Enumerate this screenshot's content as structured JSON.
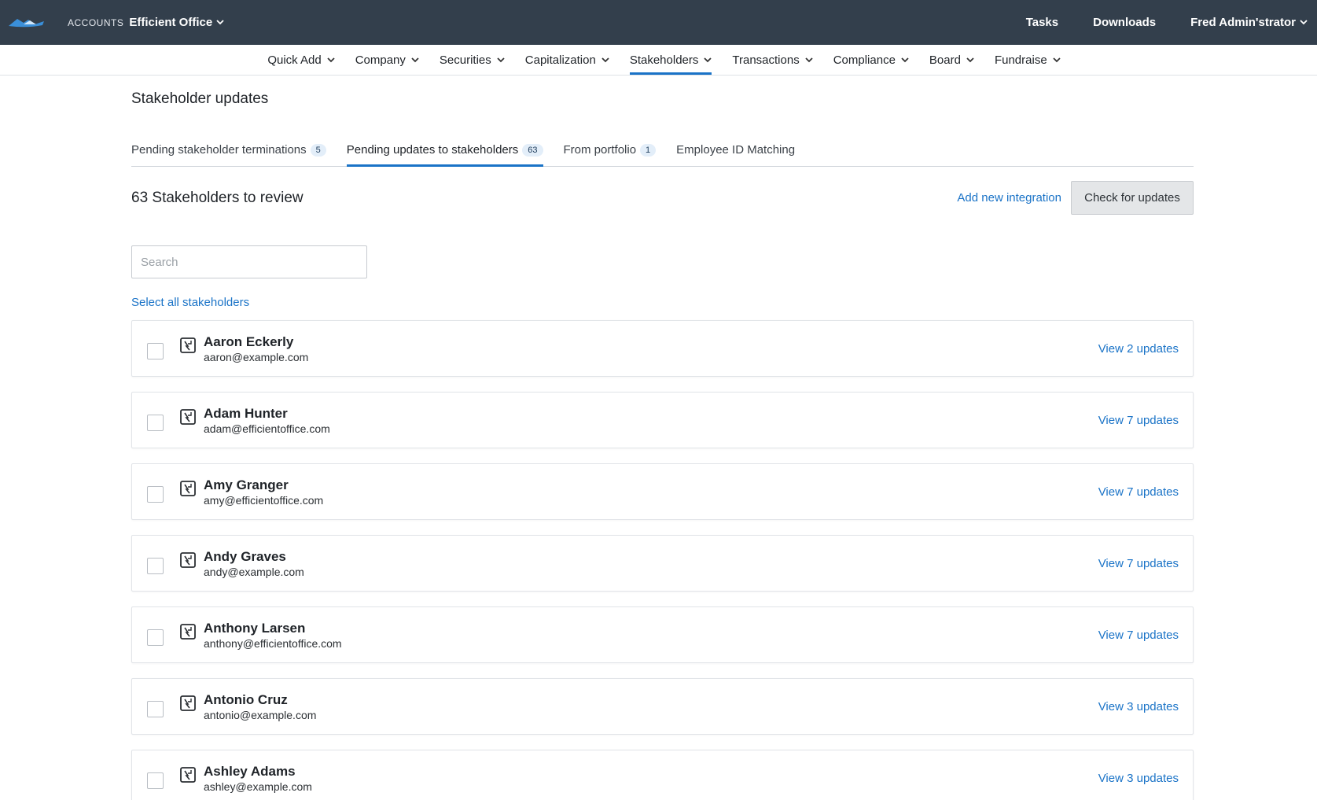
{
  "topbar": {
    "accounts_label": "ACCOUNTS",
    "company_name": "Efficient Office",
    "tasks": "Tasks",
    "downloads": "Downloads",
    "user_name": "Fred Admin'strator"
  },
  "nav": {
    "items": [
      {
        "label": "Quick Add"
      },
      {
        "label": "Company"
      },
      {
        "label": "Securities"
      },
      {
        "label": "Capitalization"
      },
      {
        "label": "Stakeholders",
        "active": true
      },
      {
        "label": "Transactions"
      },
      {
        "label": "Compliance"
      },
      {
        "label": "Board"
      },
      {
        "label": "Fundraise"
      }
    ]
  },
  "page": {
    "title": "Stakeholder updates",
    "tabs": [
      {
        "label": "Pending stakeholder terminations",
        "badge": "5"
      },
      {
        "label": "Pending updates to stakeholders",
        "badge": "63",
        "active": true
      },
      {
        "label": "From portfolio",
        "badge": "1"
      },
      {
        "label": "Employee ID Matching"
      }
    ],
    "review_count": "63 Stakeholders to review",
    "add_integration": "Add new integration",
    "check_updates": "Check for updates",
    "search_placeholder": "Search",
    "select_all": "Select all stakeholders"
  },
  "stakeholders": [
    {
      "name": "Aaron Eckerly",
      "email": "aaron@example.com",
      "link": "View 2 updates"
    },
    {
      "name": "Adam Hunter",
      "email": "adam@efficientoffice.com",
      "link": "View 7 updates"
    },
    {
      "name": "Amy Granger",
      "email": "amy@efficientoffice.com",
      "link": "View 7 updates"
    },
    {
      "name": "Andy Graves",
      "email": "andy@example.com",
      "link": "View 7 updates"
    },
    {
      "name": "Anthony Larsen",
      "email": "anthony@efficientoffice.com",
      "link": "View 7 updates"
    },
    {
      "name": "Antonio Cruz",
      "email": "antonio@example.com",
      "link": "View 3 updates"
    },
    {
      "name": "Ashley Adams",
      "email": "ashley@example.com",
      "link": "View 3 updates"
    }
  ],
  "colors": {
    "topbar": "#333f4c",
    "accent": "#1a73c7"
  }
}
